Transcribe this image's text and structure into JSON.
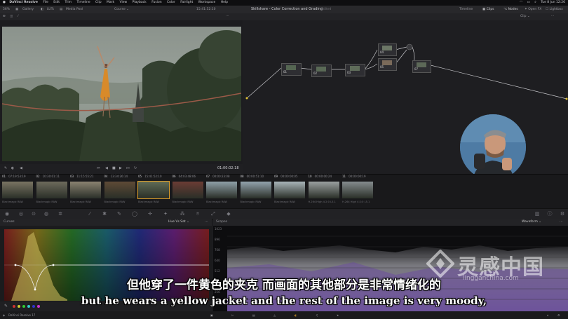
{
  "menubar": {
    "app": "DaVinci Resolve",
    "items": [
      "File",
      "Edit",
      "Trim",
      "Timeline",
      "Clip",
      "Mark",
      "View",
      "Playback",
      "Fusion",
      "Color",
      "Fairlight",
      "Workspace",
      "Help"
    ],
    "clock": "Tue 8 Jun  12:26"
  },
  "toolbar": {
    "zoom": "56%",
    "gallery": "Gallery",
    "luts": "LUTs",
    "media_pool": "Media Pool",
    "timeline_name": "Course",
    "timecode": "15:41:52:10",
    "project_title": "Skillshare - Color Correction and Grading",
    "edited": "Edited",
    "timeline_btn": "Timeline",
    "clips_btn": "Clips",
    "nodes_btn": "Nodes",
    "openfx_btn": "Open FX",
    "lightbox_btn": "Lightbox",
    "clip_mode": "Clip"
  },
  "viewer": {
    "playhead_tc": "01:00:02:18"
  },
  "nodes": [
    {
      "id": "01"
    },
    {
      "id": "02"
    },
    {
      "id": "03"
    },
    {
      "id": "04"
    },
    {
      "id": "05"
    },
    {
      "id": "06"
    },
    {
      "id": "07"
    }
  ],
  "clips": [
    {
      "num": "01",
      "tc": "07:19:53:19",
      "codec": "Blackmagic RAW",
      "color": "#7a7462"
    },
    {
      "num": "02",
      "tc": "10:30:01:11",
      "codec": "Blackmagic RAW",
      "color": "#6d6a5c"
    },
    {
      "num": "03",
      "tc": "11:15:55:21",
      "codec": "Blackmagic RAW",
      "color": "#8a8270"
    },
    {
      "num": "04",
      "tc": "13:34:26:14",
      "codec": "Blackmagic RAW",
      "color": "#5e4a36"
    },
    {
      "num": "05",
      "tc": "15:41:52:10",
      "codec": "Blackmagic RAW",
      "color": "#5f6a55"
    },
    {
      "num": "06",
      "tc": "04:03:48:06",
      "codec": "Blackmagic RAW",
      "color": "#6a3c34"
    },
    {
      "num": "07",
      "tc": "00:00:23:08",
      "codec": "Blackmagic RAW",
      "color": "#8fa0a8"
    },
    {
      "num": "08",
      "tc": "00:00:51:10",
      "codec": "Blackmagic RAW",
      "color": "#93a3ad"
    },
    {
      "num": "09",
      "tc": "00:00:00:05",
      "codec": "Blackmagic RAW",
      "color": "#a8b4b8"
    },
    {
      "num": "10",
      "tc": "00:00:00:24",
      "codec": "H.264 High 4:2:0 L5.1",
      "color": "#9aa0a0"
    },
    {
      "num": "11",
      "tc": "00:00:00:19",
      "codec": "H.264 High 4:2:0 L5.1",
      "color": "#858c8e"
    }
  ],
  "curves": {
    "title": "Curves",
    "mode": "Hue Vs Sat"
  },
  "scopes": {
    "title": "Scopes",
    "mode": "Waveform",
    "scale": [
      "1023",
      "896",
      "768",
      "640",
      "512",
      "384",
      "256",
      "128"
    ]
  },
  "statusbar": {
    "app_version": "DaVinci Resolve 17"
  },
  "subtitles": {
    "zh": "但他穿了一件黄色的夹克 而画面的其他部分是非常情绪化的",
    "en": "but he wears a yellow jacket and the rest of the image is very moody,"
  },
  "watermark": {
    "text": "灵感中国",
    "url": "lingganchina.com"
  },
  "colors": {
    "accent": "#e0a02a",
    "panel": "#232326",
    "background": "#1c1c1f"
  }
}
